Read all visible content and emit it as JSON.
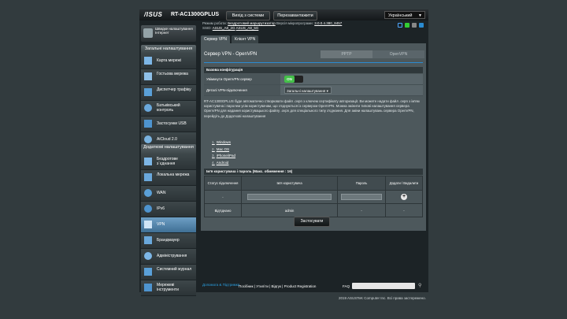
{
  "header": {
    "logo": "/ISUS",
    "model": "RT-AC1300GPLUS",
    "logout": "Вихід з системи",
    "reboot": "Перезавантажити",
    "language": "Український"
  },
  "status": {
    "mode_label": "Режим роботи:",
    "mode_value": "Бездротовий маршрутизатор",
    "fw_label": "Версія мікропрограми:",
    "fw_value": "3.0.0.4.380_8457",
    "ssid_label": "SSID:",
    "ssid_24": "ASUS_A8_2G",
    "ssid_5": "ASUS_A8_5G"
  },
  "sidebar": {
    "qis": "Швидке налаштування Інтернет",
    "general_header": "Загальні налаштування",
    "general_items": [
      {
        "label": "Карта мережі"
      },
      {
        "label": "Гостьова мережа"
      },
      {
        "label": "Диспетчер трафіку"
      },
      {
        "label": "Батьківський контроль"
      },
      {
        "label": "Застосунки USB"
      },
      {
        "label": "AiCloud 2.0"
      }
    ],
    "advanced_header": "Додаткові налаштування",
    "advanced_items": [
      {
        "label": "Бездротове з`єднання"
      },
      {
        "label": "Локальна мережа"
      },
      {
        "label": "WAN"
      },
      {
        "label": "IPv6"
      },
      {
        "label": "VPN"
      },
      {
        "label": "Брандмауер"
      },
      {
        "label": "Адміністрування"
      },
      {
        "label": "Системний журнал"
      },
      {
        "label": "Мережеві інструменти"
      }
    ]
  },
  "tabs": [
    "Сервер VPN",
    "Клієнт VPN"
  ],
  "panel": {
    "title": "Сервер VPN - OpenVPN",
    "seg_pptp": "PPTP",
    "seg_openvpn": "OpenVPN",
    "basic_header": "Базова конфігурація",
    "enable_label": "Увімкнути OpenVPN сервер",
    "toggle_state": "ON",
    "details_label": "Деталі VPN-підключення",
    "details_value": "Загальні налаштування",
    "description": "RT-AC1300GPLUS буде автоматично створювати файл .ovpn з ключем сертифікату авторизації. Ви можете надати файл .ovpn з ім'ям користувача і паролем усім користувачам, що з'єднуються із сервером OpenVPN. Можна змінити типові налаштування сервера OpenVPN для надання користувацького файлу .ovpn для спеціального типу з'єднання. Для зміни налаштувань сервера OpenVPN, перейдіть до Додаткові налаштування",
    "links": [
      {
        "n": "1.",
        "label": "Windows"
      },
      {
        "n": "2.",
        "label": "Mac OS"
      },
      {
        "n": "3.",
        "label": "iPhone/iPad"
      },
      {
        "n": "4.",
        "label": "Android"
      }
    ],
    "users_header": "Ім'я користувача і пароль (Макс. обмеження : 16)",
    "col_status": "Статус підключення",
    "col_user": "Ім'я користувача",
    "col_pass": "Пароль",
    "col_action": "Додати / Видалити",
    "new_row_status": "-",
    "user_row": {
      "status": "Від'єднано",
      "user": "admin",
      "pass": "-",
      "action": "-"
    },
    "apply": "Застосувати"
  },
  "footer": {
    "help": "Допомога & Підтримка",
    "links": "Посібник | Утиліти | Відгук | Product Registration",
    "faq": "FAQ",
    "copyright": "2019 ASUSTeK Computer Inc. Всі права застережено."
  },
  "colors": {
    "accent": "#2a8bd1",
    "toggle_on": "#45c04a",
    "active_menu": "#5b8db5"
  }
}
